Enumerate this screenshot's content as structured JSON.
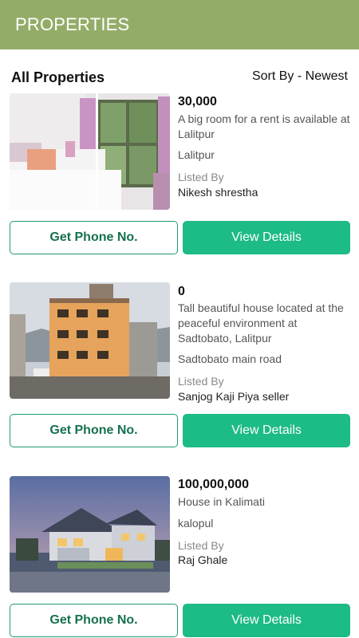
{
  "app_bar": {
    "title": "PROPERTIES"
  },
  "section": {
    "title": "All Properties",
    "sort_label": "Sort By - Newest"
  },
  "properties": [
    {
      "price": "30,000",
      "description": "A big room for a rent is available at Lalitpur",
      "location": "Lalitpur",
      "listed_by_label": "Listed By",
      "owner": "Nikesh shrestha",
      "phone_button": "Get Phone No.",
      "details_button": "View Details"
    },
    {
      "price": "0",
      "description": "Tall beautiful house located at the peaceful environment at Sadtobato, Lalitpur",
      "location": "Sadtobato main road",
      "listed_by_label": "Listed By",
      "owner": "Sanjog Kaji Piya seller",
      "phone_button": "Get Phone No.",
      "details_button": "View Details"
    },
    {
      "price": "100,000,000",
      "description": "House in Kalimati",
      "location": "kalopul",
      "listed_by_label": "Listed By",
      "owner": "Raj Ghale",
      "phone_button": "Get Phone No.",
      "details_button": "View Details"
    }
  ],
  "colors": {
    "app_bar": "#93ad68",
    "primary_button": "#1dbb85",
    "outline_button": "#1f9a6e"
  }
}
